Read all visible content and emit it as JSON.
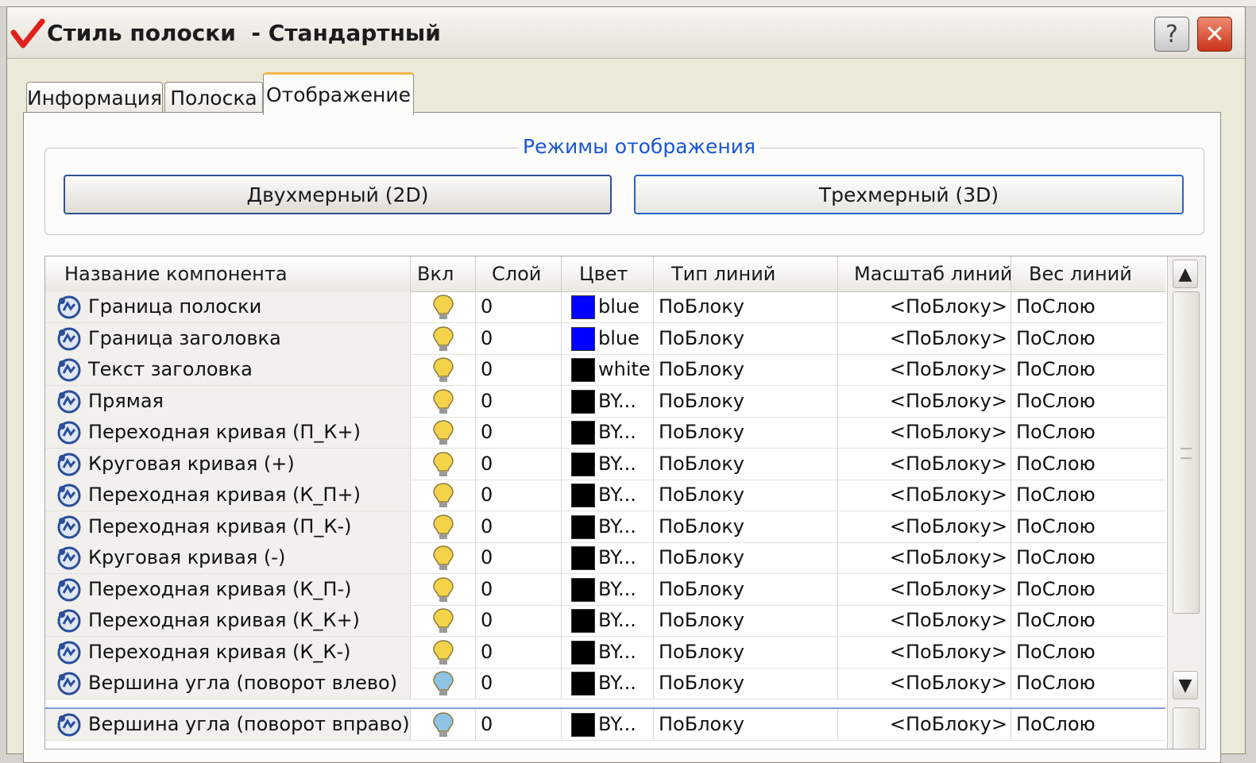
{
  "window": {
    "title": "Стиль полоски  - Стандартный",
    "help": "?",
    "close": "✕"
  },
  "tabs": [
    {
      "label": "Информация"
    },
    {
      "label": "Полоска"
    },
    {
      "label": "Отображение"
    }
  ],
  "modes": {
    "title": "Режимы отображения",
    "btn2d": "Двухмерный (2D)",
    "btn3d": "Трехмерный (3D)"
  },
  "grid": {
    "columns": [
      "Название компонента",
      "Вкл",
      "Слой",
      "Цвет",
      "Тип линий",
      "Масштаб линий",
      "Вес линий"
    ],
    "rows": [
      {
        "name": "Граница полоски",
        "on": true,
        "layer": "0",
        "color_hex": "#0000ff",
        "color": "blue",
        "ltype": "ПоБлоку",
        "lscale": "<ПоБлоку>",
        "lweight": "ПоСлою"
      },
      {
        "name": "Граница заголовка",
        "on": true,
        "layer": "0",
        "color_hex": "#0000ff",
        "color": "blue",
        "ltype": "ПоБлоку",
        "lscale": "<ПоБлоку>",
        "lweight": "ПоСлою"
      },
      {
        "name": "Текст заголовка",
        "on": true,
        "layer": "0",
        "color_hex": "#000000",
        "color": "white",
        "ltype": "ПоБлоку",
        "lscale": "<ПоБлоку>",
        "lweight": "ПоСлою"
      },
      {
        "name": "Прямая",
        "on": true,
        "layer": "0",
        "color_hex": "#000000",
        "color": "BY...",
        "ltype": "ПоБлоку",
        "lscale": "<ПоБлоку>",
        "lweight": "ПоСлою"
      },
      {
        "name": "Переходная кривая (П_К+)",
        "on": true,
        "layer": "0",
        "color_hex": "#000000",
        "color": "BY...",
        "ltype": "ПоБлоку",
        "lscale": "<ПоБлоку>",
        "lweight": "ПоСлою"
      },
      {
        "name": "Круговая кривая (+)",
        "on": true,
        "layer": "0",
        "color_hex": "#000000",
        "color": "BY...",
        "ltype": "ПоБлоку",
        "lscale": "<ПоБлоку>",
        "lweight": "ПоСлою"
      },
      {
        "name": "Переходная кривая (К_П+)",
        "on": true,
        "layer": "0",
        "color_hex": "#000000",
        "color": "BY...",
        "ltype": "ПоБлоку",
        "lscale": "<ПоБлоку>",
        "lweight": "ПоСлою"
      },
      {
        "name": "Переходная кривая (П_К-)",
        "on": true,
        "layer": "0",
        "color_hex": "#000000",
        "color": "BY...",
        "ltype": "ПоБлоку",
        "lscale": "<ПоБлоку>",
        "lweight": "ПоСлою"
      },
      {
        "name": "Круговая кривая (-)",
        "on": true,
        "layer": "0",
        "color_hex": "#000000",
        "color": "BY...",
        "ltype": "ПоБлоку",
        "lscale": "<ПоБлоку>",
        "lweight": "ПоСлою"
      },
      {
        "name": "Переходная кривая (К_П-)",
        "on": true,
        "layer": "0",
        "color_hex": "#000000",
        "color": "BY...",
        "ltype": "ПоБлоку",
        "lscale": "<ПоБлоку>",
        "lweight": "ПоСлою"
      },
      {
        "name": "Переходная кривая (К_К+)",
        "on": true,
        "layer": "0",
        "color_hex": "#000000",
        "color": "BY...",
        "ltype": "ПоБлоку",
        "lscale": "<ПоБлоку>",
        "lweight": "ПоСлою"
      },
      {
        "name": "Переходная кривая (К_К-)",
        "on": true,
        "layer": "0",
        "color_hex": "#000000",
        "color": "BY...",
        "ltype": "ПоБлоку",
        "lscale": "<ПоБлоку>",
        "lweight": "ПоСлою"
      },
      {
        "name": "Вершина угла (поворот влево)",
        "on": false,
        "layer": "0",
        "color_hex": "#000000",
        "color": "BY...",
        "ltype": "ПоБлоку",
        "lscale": "<ПоБлоку>",
        "lweight": "ПоСлою"
      },
      {
        "name": "Вершина угла (поворот вправо)",
        "on": false,
        "layer": "0",
        "color_hex": "#000000",
        "color": "BY...",
        "ltype": "ПоБлоку",
        "lscale": "<ПоБлоку>",
        "lweight": "ПоСлою"
      }
    ]
  },
  "colors": {
    "bulb_on": "#f4d34a",
    "bulb_off": "#8fc3e6",
    "accent_tab": "#f5b54b",
    "group_title": "#1a55d6"
  },
  "icons": {
    "app": "checkmark-icon",
    "component": "component-style-icon",
    "bulb": "lightbulb-icon"
  }
}
